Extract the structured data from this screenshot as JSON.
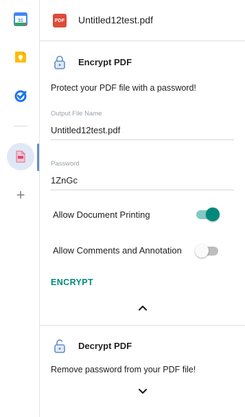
{
  "rail": {
    "apps": [
      {
        "name": "calendar-icon",
        "text": "31"
      },
      {
        "name": "keep-icon"
      },
      {
        "name": "tasks-icon"
      }
    ],
    "active_app": "pdf-addon-icon",
    "add_label": "+"
  },
  "file": {
    "badge": "PDF",
    "name": "Untitled12test.pdf"
  },
  "encrypt": {
    "title": "Encrypt PDF",
    "description": "Protect your PDF file with a password!",
    "output_label": "Output File Name",
    "output_value": "Untitled12test.pdf",
    "password_label": "Password",
    "password_value": "1ZnGc",
    "allow_printing_label": "Allow Document Printing",
    "allow_printing": true,
    "allow_comments_label": "Allow Comments and Annotation",
    "allow_comments": false,
    "button_label": "ENCRYPT"
  },
  "decrypt": {
    "title": "Decrypt PDF",
    "description": "Remove password from your PDF file!"
  },
  "colors": {
    "accent": "#00897b",
    "pdf_red": "#dd4b39",
    "lock_blue": "#5f8fc7"
  }
}
